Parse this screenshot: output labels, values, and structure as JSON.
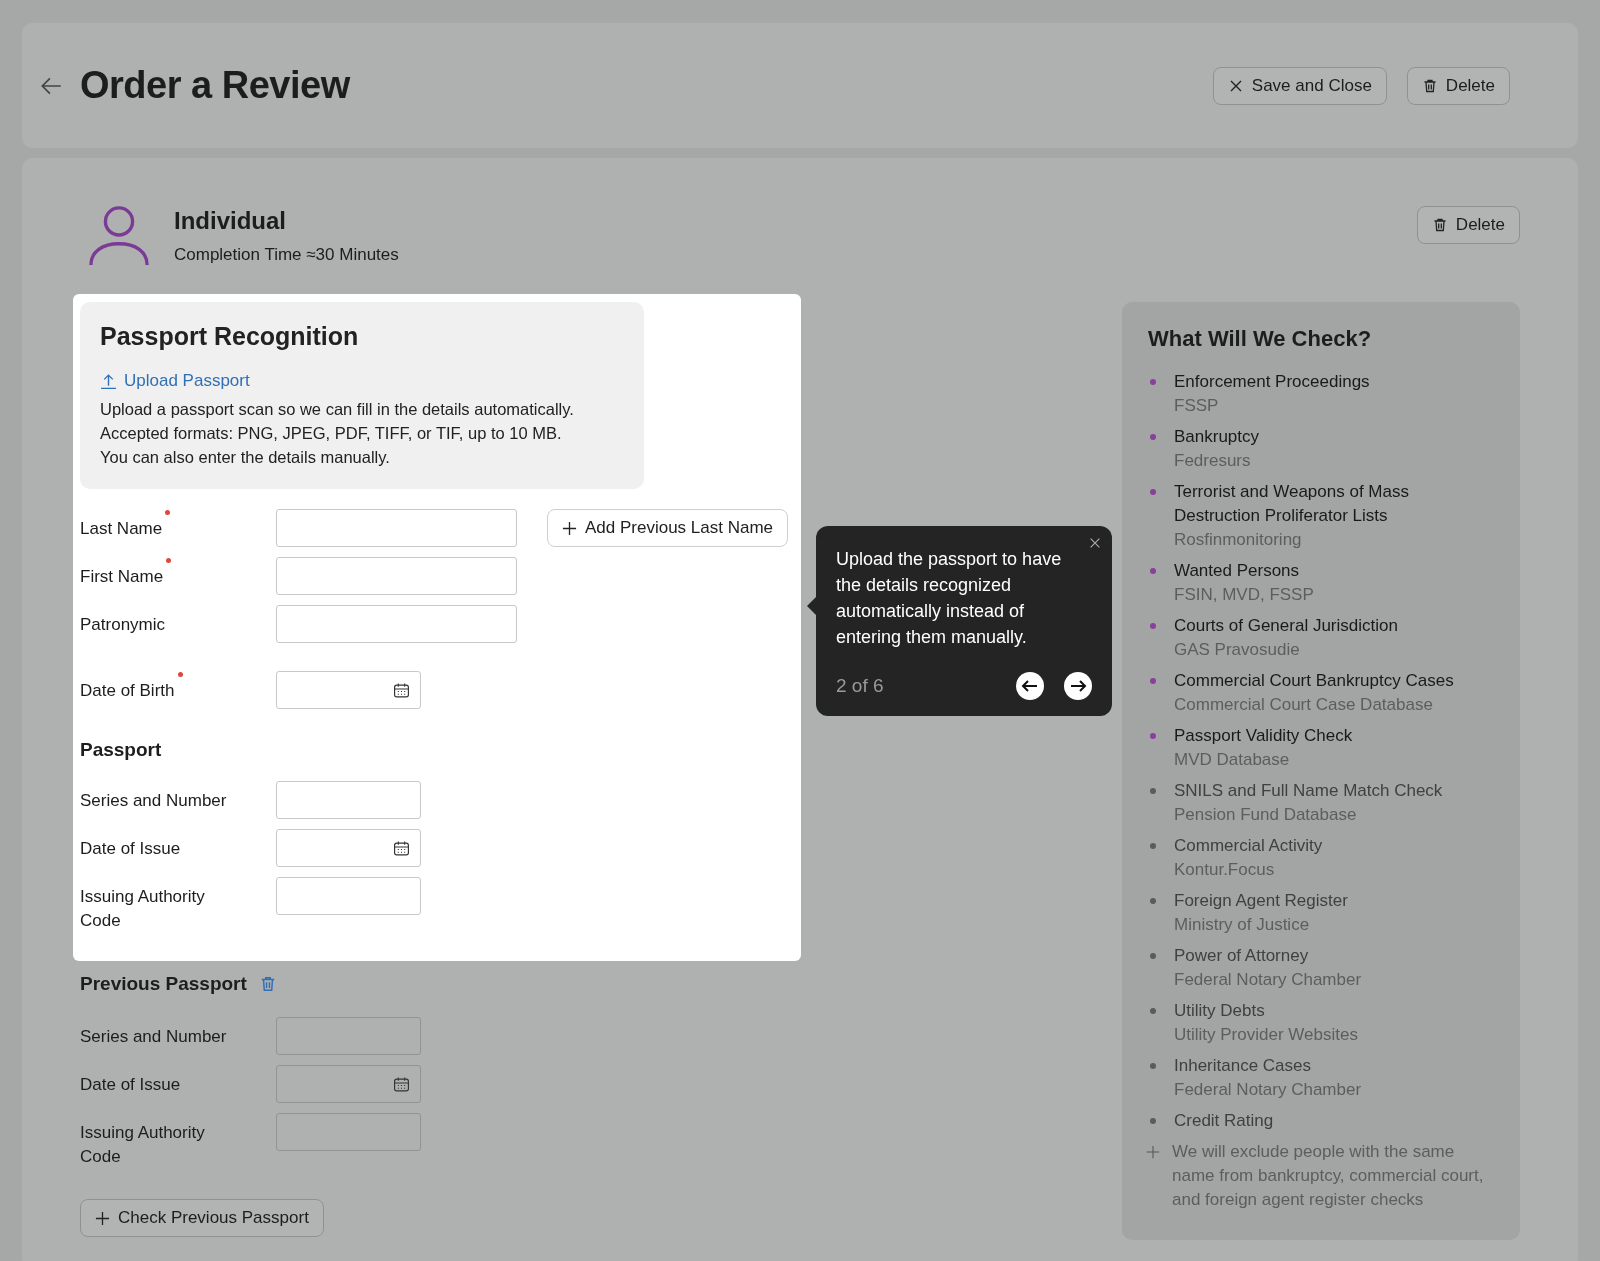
{
  "header": {
    "title": "Order a Review",
    "buttons": [
      {
        "kind": "close",
        "label": "Save and Close"
      },
      {
        "kind": "delete",
        "label": "Delete"
      }
    ]
  },
  "subject": {
    "title": "Individual",
    "subtitle": "Completion Time ≈30 Minutes",
    "delete_label": "Delete"
  },
  "recognition": {
    "title": "Passport Recognition",
    "upload_link": "Upload Passport",
    "description": [
      "Upload a passport scan so we can fill in the details automatically.",
      "Accepted formats: PNG, JPEG, PDF, TIFF, or TIF, up to 10 MB.",
      "You can also enter the details manually."
    ]
  },
  "personal_fields": [
    {
      "label": "Last Name",
      "required": true,
      "kind": "name"
    },
    {
      "label": "First Name",
      "required": true,
      "kind": "name"
    },
    {
      "label": "Patronymic",
      "required": false,
      "kind": "name"
    },
    {
      "label": "Date of Birth",
      "required": true,
      "kind": "date"
    }
  ],
  "add_previous_name_button": "Add Previous Last Name",
  "passport": {
    "title": "Passport",
    "fields": [
      {
        "label": "Series and Number",
        "kind": "code"
      },
      {
        "label": "Date of Issue",
        "kind": "date"
      },
      {
        "label": "Issuing Authority Code",
        "kind": "code"
      }
    ]
  },
  "previous_passport": {
    "title": "Previous Passport",
    "fields": [
      {
        "label": "Series and Number",
        "kind": "code"
      },
      {
        "label": "Date of Issue",
        "kind": "date"
      },
      {
        "label": "Issuing Authority Code",
        "kind": "code"
      }
    ],
    "add_button": "Check Previous Passport"
  },
  "checks": {
    "title": "What Will We Check?",
    "items": [
      {
        "name": "Enforcement Proceedings",
        "source": "FSSP",
        "included": true
      },
      {
        "name": "Bankruptcy",
        "source": "Fedresurs",
        "included": true
      },
      {
        "name": "Terrorist and Weapons of Mass Destruction Proliferator Lists",
        "source": "Rosfinmonitoring",
        "included": true
      },
      {
        "name": "Wanted Persons",
        "source": "FSIN, MVD, FSSP",
        "included": true
      },
      {
        "name": "Courts of General Jurisdiction",
        "source": "GAS Pravosudie",
        "included": true
      },
      {
        "name": "Commercial Court Bankruptcy Cases",
        "source": "Commercial Court Case Database",
        "included": true
      },
      {
        "name": "Passport Validity Check",
        "source": "MVD Database",
        "included": true
      },
      {
        "name": "SNILS and Full Name Match Check",
        "source": "Pension Fund Database",
        "included": false
      },
      {
        "name": "Commercial Activity",
        "source": "Kontur.Focus",
        "included": false
      },
      {
        "name": "Foreign Agent Register",
        "source": "Ministry of Justice",
        "included": false
      },
      {
        "name": "Power of Attorney",
        "source": "Federal Notary Chamber",
        "included": false
      },
      {
        "name": "Utility Debts",
        "source": "Utility Provider Websites",
        "included": false
      },
      {
        "name": "Inheritance Cases",
        "source": "Federal Notary Chamber",
        "included": false
      },
      {
        "name": "Credit Rating",
        "included": false
      }
    ],
    "note": "We will exclude people with the same name from bankruptcy, commercial court, and foreign agent register checks"
  },
  "tour": {
    "text": "Upload the passport to have the details recognized automatically instead of entering them manually.",
    "step": "2 of 6"
  }
}
